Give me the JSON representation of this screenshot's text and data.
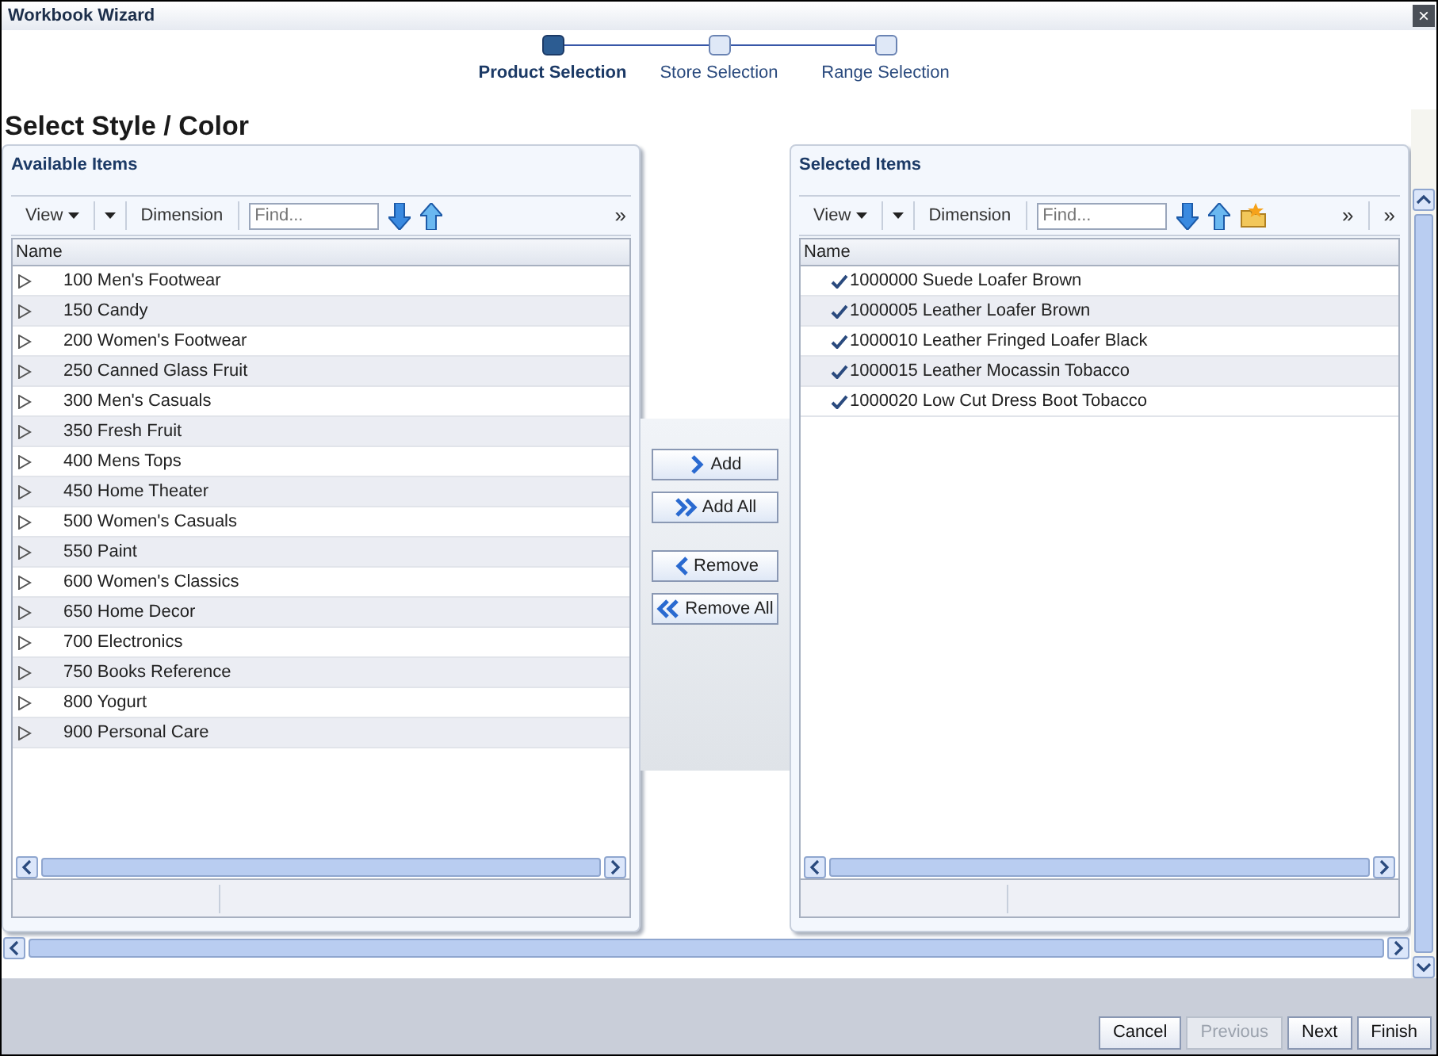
{
  "window": {
    "title": "Workbook Wizard",
    "close": "×"
  },
  "wizard_steps": [
    {
      "label": "Product Selection",
      "selected": true
    },
    {
      "label": "Store Selection",
      "selected": false
    },
    {
      "label": "Range Selection",
      "selected": false
    }
  ],
  "page_title": "Select Style / Color",
  "panels": [
    {
      "title": "Available Items",
      "kind": "tree",
      "view": "View",
      "dimension": "Dimension",
      "find_placeholder": "Find...",
      "overflow": [
        "»"
      ],
      "column": "Name",
      "rows": [
        {
          "label": "100 Men's Footwear"
        },
        {
          "label": "150 Candy"
        },
        {
          "label": "200 Women's Footwear"
        },
        {
          "label": "250 Canned Glass Fruit"
        },
        {
          "label": "300 Men's Casuals"
        },
        {
          "label": "350 Fresh Fruit"
        },
        {
          "label": "400 Mens Tops"
        },
        {
          "label": "450 Home Theater"
        },
        {
          "label": "500 Women's Casuals"
        },
        {
          "label": "550 Paint"
        },
        {
          "label": "600 Women's Classics"
        },
        {
          "label": "650 Home Decor"
        },
        {
          "label": "700 Electronics"
        },
        {
          "label": "750 Books Reference"
        },
        {
          "label": "800 Yogurt"
        },
        {
          "label": "900 Personal Care"
        }
      ]
    },
    {
      "title": "Selected Items",
      "kind": "checked",
      "view": "View",
      "dimension": "Dimension",
      "find_placeholder": "Find...",
      "overflow": [
        "»",
        "»"
      ],
      "column": "Name",
      "rows": [
        {
          "label": "1000000 Suede Loafer Brown"
        },
        {
          "label": "1000005 Leather Loafer Brown"
        },
        {
          "label": "1000010 Leather Fringed Loafer Black"
        },
        {
          "label": "1000015 Leather Mocassin Tobacco"
        },
        {
          "label": "1000020 Low Cut Dress Boot Tobacco"
        }
      ]
    }
  ],
  "shuttle_buttons": [
    {
      "label": "Add",
      "kind": "one"
    },
    {
      "label": "Add All",
      "kind": "all"
    },
    {
      "label": "Remove",
      "kind": "remove-one"
    },
    {
      "label": "Remove All",
      "kind": "remove-all"
    }
  ],
  "footer_buttons": [
    {
      "label": "Cancel",
      "disabled": false
    },
    {
      "label": "Previous",
      "disabled": true
    },
    {
      "label": "Next",
      "disabled": false
    },
    {
      "label": "Finish",
      "disabled": false
    }
  ]
}
